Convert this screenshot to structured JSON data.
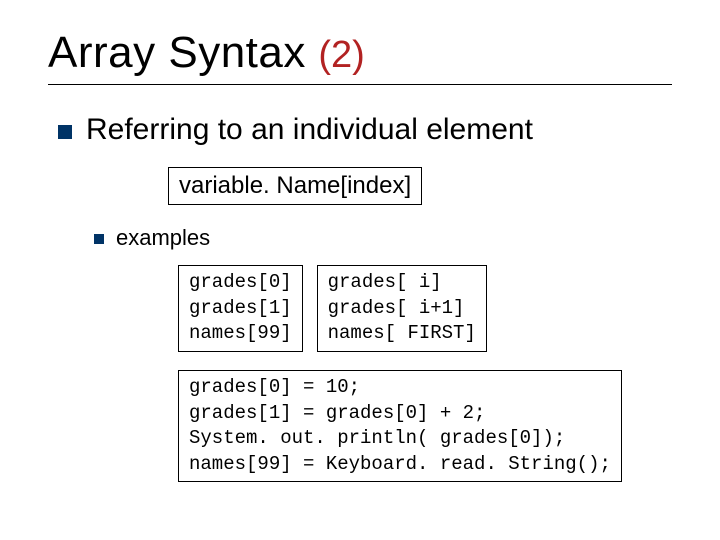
{
  "title": {
    "main": "Array Syntax",
    "sub": "(2)"
  },
  "bullets": {
    "l1": "Referring to an individual element",
    "l2": "examples"
  },
  "syntax_box": "variable. Name[index]",
  "examples_left": "grades[0]\ngrades[1]\nnames[99]",
  "examples_right": "grades[ i]\ngrades[ i+1]\nnames[ FIRST]",
  "statements": "grades[0] = 10;\ngrades[1] = grades[0] + 2;\nSystem. out. println( grades[0]);\nnames[99] = Keyboard. read. String();"
}
